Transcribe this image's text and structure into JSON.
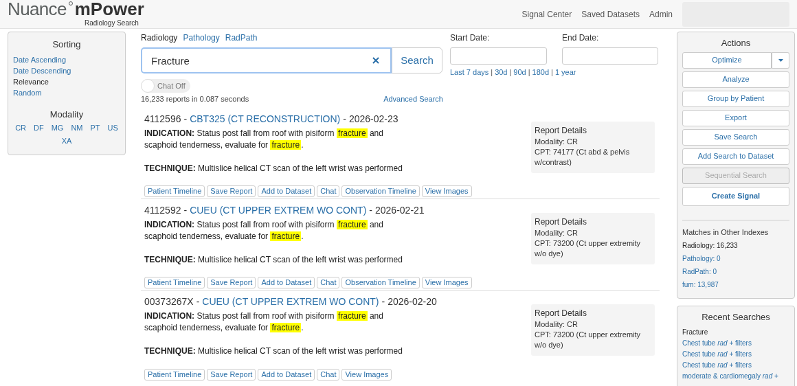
{
  "header": {
    "brand": "Nuance",
    "product": "mPower",
    "subtitle": "Radiology Search",
    "nav": [
      "Signal Center",
      "Saved Datasets",
      "Admin"
    ]
  },
  "sorting": {
    "title": "Sorting",
    "items": [
      {
        "label": "Date Ascending",
        "selected": false
      },
      {
        "label": "Date Descending",
        "selected": false
      },
      {
        "label": "Relevance",
        "selected": true
      },
      {
        "label": "Random",
        "selected": false
      }
    ]
  },
  "modality": {
    "title": "Modality",
    "items": [
      "CR",
      "DF",
      "MG",
      "NM",
      "PT",
      "US",
      "XA"
    ]
  },
  "sources": [
    {
      "label": "Radiology",
      "selected": true
    },
    {
      "label": "Pathology",
      "selected": false
    },
    {
      "label": "RadPath",
      "selected": false
    }
  ],
  "search": {
    "value": "Fracture",
    "button": "Search"
  },
  "chat": {
    "label": "Chat Off",
    "on": false
  },
  "result_count": "16,233 reports in 0.087 seconds",
  "advanced_search": "Advanced Search",
  "dates": {
    "start_label": "Start Date:",
    "end_label": "End Date:",
    "separator": "|",
    "presets": [
      "Last 7 days",
      "30d",
      "90d",
      "180d",
      "1 year"
    ]
  },
  "reports": [
    {
      "id": "4112596",
      "dash": "-",
      "code": "CBT325 (CT RECONSTRUCTION)",
      "date": "2026-02-23",
      "indication_label": "INDICATION:",
      "indication": [
        {
          "text": "Status post fall from roof with pisiform",
          "highlight": false
        },
        {
          "text": "fracture",
          "highlight": true
        },
        {
          "text": "and scaphoid tenderness, evaluate for",
          "highlight": false
        },
        {
          "text": "fracture",
          "highlight": true
        },
        {
          "text": ".",
          "highlight": false
        }
      ],
      "technique_label": "TECHNIQUE:",
      "technique": "Multislice helical CT scan of the left wrist was performed",
      "details_title": "Report Details",
      "details": [
        "Modality: CR",
        "CPT: 74177 (Ct abd & pelvis w/contrast)"
      ],
      "buttons": [
        "Patient Timeline",
        "Save Report",
        "Add to Dataset",
        "Chat",
        "Observation Timeline",
        "View Images"
      ]
    },
    {
      "id": "4112592",
      "dash": "-",
      "code": "CUEU (CT UPPER EXTREM WO CONT)",
      "date": "2026-02-21",
      "indication_label": "INDICATION:",
      "indication": [
        {
          "text": "Status post fall from roof with pisiform",
          "highlight": false
        },
        {
          "text": "fracture",
          "highlight": true
        },
        {
          "text": "and scaphoid tenderness, evaluate for",
          "highlight": false
        },
        {
          "text": "fracture",
          "highlight": true
        },
        {
          "text": ".",
          "highlight": false
        }
      ],
      "technique_label": "TECHNIQUE:",
      "technique": "Multislice helical CT scan of the left wrist was performed",
      "details_title": "Report Details",
      "details": [
        "Modality: CR",
        "CPT: 73200 (Ct upper extremity w/o dye)"
      ],
      "buttons": [
        "Patient Timeline",
        "Save Report",
        "Add to Dataset",
        "Chat",
        "Observation Timeline",
        "View Images"
      ]
    },
    {
      "id": "00373267X",
      "dash": "-",
      "code": "CUEU (CT UPPER EXTREM WO CONT)",
      "date": "2026-02-20",
      "indication_label": "INDICATION:",
      "indication": [
        {
          "text": "Status post fall from roof with pisiform",
          "highlight": false
        },
        {
          "text": "fracture",
          "highlight": true
        },
        {
          "text": "and scaphoid tenderness, evaluate for",
          "highlight": false
        },
        {
          "text": "fracture",
          "highlight": true
        },
        {
          "text": ".",
          "highlight": false
        }
      ],
      "technique_label": "TECHNIQUE:",
      "technique": "Multislice helical CT scan of the left wrist was performed",
      "details_title": "Report Details",
      "details": [
        "Modality: CR",
        "CPT: 73200 (Ct upper extremity w/o dye)"
      ],
      "buttons": [
        "Patient Timeline",
        "Save Report",
        "Add to Dataset",
        "Chat",
        "View Images"
      ]
    }
  ],
  "actions": {
    "title": "Actions",
    "items": [
      {
        "label": "Optimize",
        "disabled": false,
        "emphasized": false,
        "has_menu": true
      },
      {
        "label": "Analyze",
        "disabled": false,
        "emphasized": false,
        "has_menu": false
      },
      {
        "label": "Group by Patient",
        "disabled": false,
        "emphasized": false,
        "has_menu": false
      },
      {
        "label": "Export",
        "disabled": false,
        "emphasized": false,
        "has_menu": false
      },
      {
        "label": "Save Search",
        "disabled": false,
        "emphasized": false,
        "has_menu": false
      },
      {
        "label": "Add Search to Dataset",
        "disabled": false,
        "emphasized": false,
        "has_menu": false
      },
      {
        "label": "Sequential Search",
        "disabled": true,
        "emphasized": false,
        "has_menu": false
      },
      {
        "label": "Create Signal",
        "disabled": false,
        "emphasized": true,
        "has_menu": false
      }
    ]
  },
  "matches": {
    "title": "Matches in Other Indexes",
    "items": [
      {
        "label": "Radiology: 16,233",
        "selected": true
      },
      {
        "label": "Pathology: 0",
        "selected": false
      },
      {
        "label": "RadPath: 0",
        "selected": false
      },
      {
        "label": "fum: 13,987",
        "selected": false
      }
    ]
  },
  "recent": {
    "title": "Recent Searches",
    "items": [
      {
        "label": "Fracture",
        "selected": true
      },
      {
        "label": "Chest tube *rad* + filters",
        "selected": false
      },
      {
        "label": "Chest tube *rad* + filters",
        "selected": false
      },
      {
        "label": "Chest tube *rad* + filters",
        "selected": false
      },
      {
        "label": "moderate & cardiomegaly *rad* +",
        "selected": false
      }
    ]
  }
}
